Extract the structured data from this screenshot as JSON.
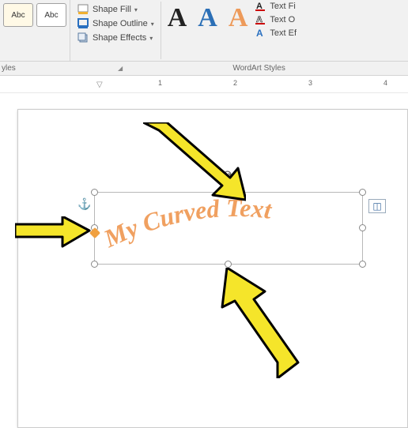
{
  "ribbon": {
    "shape_sample_label": "Abc",
    "shape_fill": "Shape Fill",
    "shape_outline": "Shape Outline",
    "shape_effects": "Shape Effects",
    "text_fill": "Text Fi",
    "text_outline": "Text O",
    "text_effects": "Text Ef"
  },
  "group_labels": {
    "shape_styles": "yles",
    "wordart_styles": "WordArt Styles"
  },
  "ruler": {
    "marks": [
      "1",
      "2",
      "3",
      "4"
    ]
  },
  "canvas": {
    "text": "My Curved Text"
  },
  "icons": {
    "fill": "shape-fill-icon",
    "outline": "shape-outline-icon",
    "effects": "shape-effects-icon",
    "text_fill": "text-fill-icon",
    "text_outline": "text-outline-icon",
    "text_effects": "text-effects-icon",
    "rotate": "rotate-icon",
    "anchor": "anchor-icon",
    "layout": "layout-options-icon"
  }
}
